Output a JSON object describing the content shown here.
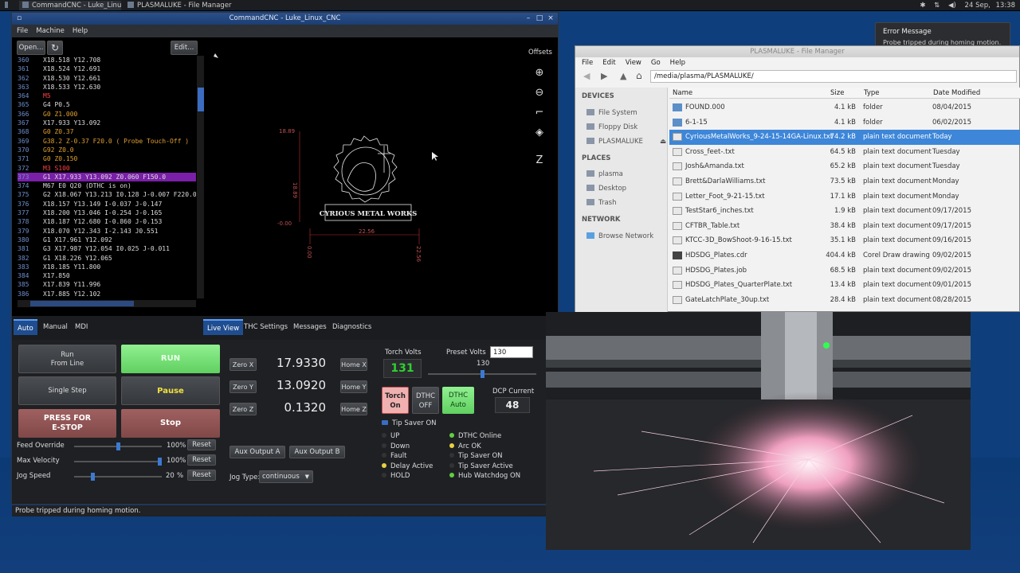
{
  "taskbar": {
    "tasks": [
      "CommandCNC - Luke_Linu...",
      "PLASMALUKE - File Manager"
    ],
    "clock_date": "24 Sep,",
    "clock_time": "13:38"
  },
  "notification": {
    "title": "Error Message",
    "message": "Probe tripped during homing motion."
  },
  "cnc": {
    "title": "CommandCNC - Luke_Linux_CNC",
    "menu": [
      "File",
      "Machine",
      "Help"
    ],
    "open_label": "Open...",
    "edit_label": "Edit...",
    "offsets_label": "Offsets",
    "gcode": [
      {
        "n": "360",
        "t": "X18.518 Y12.708"
      },
      {
        "n": "361",
        "t": "X18.524 Y12.691"
      },
      {
        "n": "362",
        "t": "X18.530 Y12.661"
      },
      {
        "n": "363",
        "t": "X18.533 Y12.630"
      },
      {
        "n": "364",
        "t": "M5"
      },
      {
        "n": "365",
        "t": "G4 P0.5"
      },
      {
        "n": "366",
        "t": "G0 Z1.000"
      },
      {
        "n": "367",
        "t": "X17.933 Y13.092"
      },
      {
        "n": "368",
        "t": "G0 Z0.37"
      },
      {
        "n": "369",
        "t": "G38.2 Z-0.37 F20.0 ( Probe Touch-Off )"
      },
      {
        "n": "370",
        "t": "G92 Z0.0"
      },
      {
        "n": "371",
        "t": "G0 Z0.150"
      },
      {
        "n": "372",
        "t": "M3 S100"
      },
      {
        "n": "373",
        "t": "G1 X17.933 Y13.092 Z0.060 F150.0"
      },
      {
        "n": "374",
        "t": "M67 E0 Q20 (DTHC is on)"
      },
      {
        "n": "375",
        "t": "G2 X18.067 Y13.213 I0.128 J-0.007 F220.0"
      },
      {
        "n": "376",
        "t": "X18.157 Y13.149 I-0.037 J-0.147"
      },
      {
        "n": "377",
        "t": "X18.200 Y13.046 I-0.254 J-0.165"
      },
      {
        "n": "378",
        "t": "X18.187 Y12.680 I-0.860 J-0.153"
      },
      {
        "n": "379",
        "t": "X18.070 Y12.343 I-2.143 J0.551"
      },
      {
        "n": "380",
        "t": "G1 X17.961 Y12.092"
      },
      {
        "n": "381",
        "t": "G3 X17.987 Y12.054 I0.025 J-0.011"
      },
      {
        "n": "382",
        "t": "G1 X18.226 Y12.065"
      },
      {
        "n": "383",
        "t": "X18.185 Y11.800"
      },
      {
        "n": "384",
        "t": "X17.850"
      },
      {
        "n": "385",
        "t": "X17.839 Y11.996"
      },
      {
        "n": "386",
        "t": "X17.885 Y12.102"
      }
    ],
    "preview": {
      "label_top": "18.89",
      "label_left": "18.89",
      "label_bottom_left": "-0.00",
      "label_width": "22.56",
      "label_x0": "0.00",
      "label_x1": "22.56",
      "logo_text": "CYRIOUS METAL WORKS"
    },
    "mode_tabs": [
      "Auto",
      "Manual",
      "MDI"
    ],
    "view_tabs": [
      "Live View",
      "THC Settings",
      "Messages",
      "Diagnostics"
    ],
    "run_from_line": "Run\nFrom Line",
    "run": "RUN",
    "single_step": "Single Step",
    "pause": "Pause",
    "estop": "PRESS FOR\nE-STOP",
    "stop": "Stop",
    "feed_override": {
      "label": "Feed Override",
      "value": "100%",
      "level": 0.5,
      "reset": "Reset"
    },
    "max_velocity": {
      "label": "Max Velocity",
      "value": "100%",
      "level": 1.0,
      "reset": "Reset"
    },
    "jog_speed": {
      "label": "Jog Speed",
      "value": "20",
      "unit": "%",
      "level": 0.2,
      "reset": "Reset"
    },
    "dro": [
      {
        "zero": "Zero X",
        "value": "17.9330",
        "home": "Home X"
      },
      {
        "zero": "Zero Y",
        "value": "13.0920",
        "home": "Home Y"
      },
      {
        "zero": "Zero Z",
        "value": "0.1320",
        "home": "Home Z"
      }
    ],
    "aux_a": "Aux Output A",
    "aux_b": "Aux Output B",
    "jog_type_label": "Jog Type:",
    "jog_type_value": "continuous",
    "thc": {
      "torch_volts_label": "Torch Volts",
      "torch_volts": "131",
      "preset_volts_label": "Preset Volts",
      "preset_volts": "130",
      "preset_slider_value": "130",
      "torch_on": "Torch\nOn",
      "dthc_off": "DTHC\nOFF",
      "dthc_auto": "DTHC\nAuto",
      "dcp_current_label": "DCP Current",
      "dcp_current": "48",
      "tip_saver": "Tip Saver ON",
      "indicators_left": [
        {
          "label": "UP",
          "color": "#333333"
        },
        {
          "label": "Down",
          "color": "#333333"
        },
        {
          "label": "Fault",
          "color": "#333333"
        },
        {
          "label": "Delay Active",
          "color": "#e8d040"
        },
        {
          "label": "HOLD",
          "color": "#333333"
        }
      ],
      "indicators_right": [
        {
          "label": "DTHC Online",
          "color": "#60d040"
        },
        {
          "label": "Arc OK",
          "color": "#e8d040"
        },
        {
          "label": "Tip Saver ON",
          "color": "#333333"
        },
        {
          "label": "Tip Saver Active",
          "color": "#333333"
        },
        {
          "label": "Hub Watchdog ON",
          "color": "#60d040"
        }
      ]
    },
    "status": "Probe tripped during homing motion."
  },
  "fm": {
    "title": "PLASMALUKE - File Manager",
    "menu": [
      "File",
      "Edit",
      "View",
      "Go",
      "Help"
    ],
    "path": "/media/plasma/PLASMALUKE/",
    "devices_header": "DEVICES",
    "devices": [
      "File System",
      "Floppy Disk",
      "PLASMALUKE"
    ],
    "places_header": "PLACES",
    "places": [
      "plasma",
      "Desktop",
      "Trash"
    ],
    "network_header": "NETWORK",
    "network": [
      "Browse Network"
    ],
    "columns": [
      "Name",
      "Size",
      "Type",
      "Date Modified"
    ],
    "files": [
      {
        "name": "FOUND.000",
        "size": "4.1 kB",
        "type": "folder",
        "date": "08/04/2015",
        "icon": "folder"
      },
      {
        "name": "6-1-15",
        "size": "4.1 kB",
        "type": "folder",
        "date": "06/02/2015",
        "icon": "folder"
      },
      {
        "name": "CyriousMetalWorks_9-24-15-14GA-Linux.txt",
        "size": "74.2 kB",
        "type": "plain text document",
        "date": "Today",
        "icon": "text"
      },
      {
        "name": "Cross_feet-.txt",
        "size": "64.5 kB",
        "type": "plain text document",
        "date": "Tuesday",
        "icon": "text"
      },
      {
        "name": "Josh&Amanda.txt",
        "size": "65.2 kB",
        "type": "plain text document",
        "date": "Tuesday",
        "icon": "text"
      },
      {
        "name": "Brett&DarlaWilliams.txt",
        "size": "73.5 kB",
        "type": "plain text document",
        "date": "Monday",
        "icon": "text"
      },
      {
        "name": "Letter_Foot_9-21-15.txt",
        "size": "17.1 kB",
        "type": "plain text document",
        "date": "Monday",
        "icon": "text"
      },
      {
        "name": "TestStar6_inches.txt",
        "size": "1.9 kB",
        "type": "plain text document",
        "date": "09/17/2015",
        "icon": "text"
      },
      {
        "name": "CFTBR_Table.txt",
        "size": "38.4 kB",
        "type": "plain text document",
        "date": "09/17/2015",
        "icon": "text"
      },
      {
        "name": "KTCC-3D_BowShoot-9-16-15.txt",
        "size": "35.1 kB",
        "type": "plain text document",
        "date": "09/16/2015",
        "icon": "text"
      },
      {
        "name": "HDSDG_Plates.cdr",
        "size": "404.4 kB",
        "type": "Corel Draw drawing",
        "date": "09/02/2015",
        "icon": "cdr"
      },
      {
        "name": "HDSDG_Plates.job",
        "size": "68.5 kB",
        "type": "plain text document",
        "date": "09/02/2015",
        "icon": "text"
      },
      {
        "name": "HDSDG_Plates_QuarterPlate.txt",
        "size": "13.4 kB",
        "type": "plain text document",
        "date": "09/01/2015",
        "icon": "text"
      },
      {
        "name": "GateLatchPlate_30up.txt",
        "size": "28.4 kB",
        "type": "plain text document",
        "date": "08/28/2015",
        "icon": "text"
      }
    ]
  }
}
